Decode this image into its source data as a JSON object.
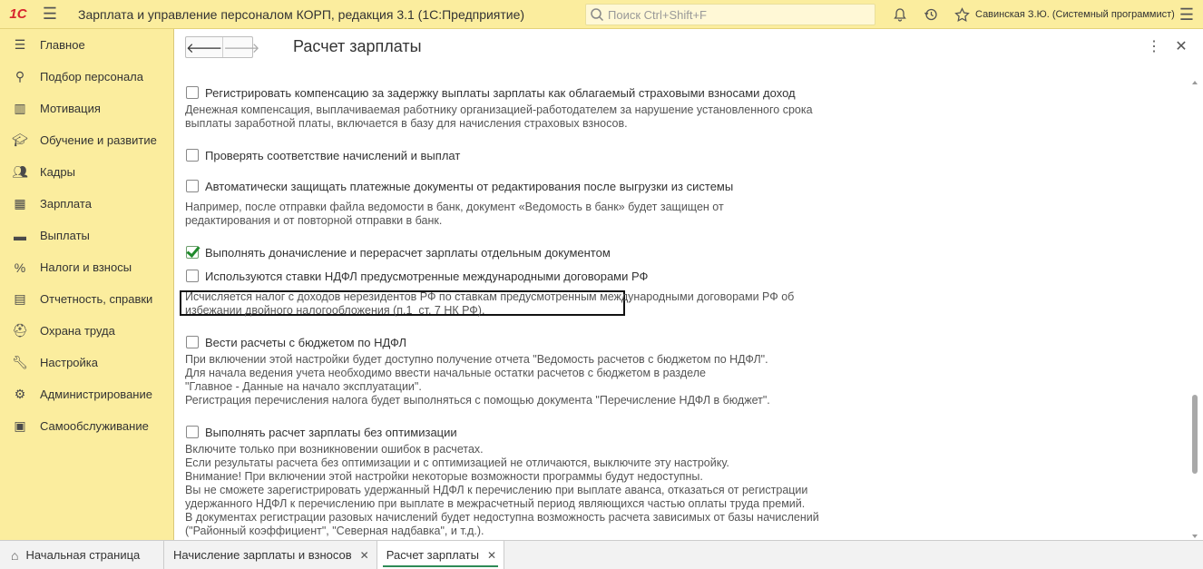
{
  "app": {
    "title": "Зарплата и управление персоналом КОРП, редакция 3.1   (1С:Предприятие)",
    "logo": "1С",
    "search_placeholder": "Поиск Ctrl+Shift+F",
    "user": "Савинская З.Ю. (Системный программист)"
  },
  "sidebar": {
    "items": [
      {
        "label": "Главное",
        "icon": "menu-lines-icon"
      },
      {
        "label": "Подбор персонала",
        "icon": "person-search-icon"
      },
      {
        "label": "Мотивация",
        "icon": "gift-icon"
      },
      {
        "label": "Обучение и развитие",
        "icon": "graduation-cap-icon"
      },
      {
        "label": "Кадры",
        "icon": "people-icon"
      },
      {
        "label": "Зарплата",
        "icon": "calculator-icon"
      },
      {
        "label": "Выплаты",
        "icon": "wallet-icon"
      },
      {
        "label": "Налоги и взносы",
        "icon": "percent-icon"
      },
      {
        "label": "Отчетность, справки",
        "icon": "report-icon"
      },
      {
        "label": "Охрана труда",
        "icon": "safety-icon"
      },
      {
        "label": "Настройка",
        "icon": "wrench-icon"
      },
      {
        "label": "Администрирование",
        "icon": "gear-icon"
      },
      {
        "label": "Самообслуживание",
        "icon": "id-card-icon"
      }
    ]
  },
  "form": {
    "title": "Расчет зарплаты"
  },
  "options": [
    {
      "label": "Регистрировать компенсацию за задержку выплаты зарплаты как облагаемый страховыми взносами доход",
      "checked": false,
      "description": "Денежная компенсация, выплачиваемая работнику организацией-работодателем за нарушение установленного срока\nвыплаты заработной платы, включается в базу для начисления страховых взносов."
    },
    {
      "label": "Проверять соответствие начислений и выплат",
      "checked": false,
      "description": ""
    },
    {
      "label": "Автоматически защищать платежные документы от редактирования после выгрузки из системы",
      "checked": false,
      "description": "Например, после отправки файла ведомости в банк, документ «Ведомость в банк» будет защищен от\nредактирования и от повторной отправки в банк."
    },
    {
      "label": "Выполнять доначисление и перерасчет зарплаты отдельным документом",
      "checked": true,
      "description": ""
    },
    {
      "label": "Используются ставки НДФЛ предусмотренные международными договорами РФ",
      "checked": false,
      "description": "Исчисляется налог с доходов нерезидентов РФ по ставкам предусмотренным международными договорами РФ об\nизбежании двойного налогообложения (п.1  ст. 7 НК РФ)."
    },
    {
      "label": "Вести расчеты с бюджетом по НДФЛ",
      "checked": false,
      "description": "При включении этой настройки будет доступно получение отчета \"Ведомость расчетов с бюджетом по НДФЛ\".\nДля начала ведения учета необходимо ввести начальные остатки расчетов с бюджетом в разделе\n\"Главное - Данные на начало эксплуатации\".\nРегистрация перечисления налога будет выполняться с помощью документа \"Перечисление НДФЛ в бюджет\"."
    },
    {
      "label": "Выполнять расчет зарплаты без оптимизации",
      "checked": false,
      "description": "Включите только при возникновении ошибок в расчетах.\nЕсли результаты расчета без оптимизации и с оптимизацией не отличаются, выключите эту настройку.\nВнимание! При включении этой настройки некоторые возможности программы будут недоступны.\nВы не сможете зарегистрировать удержанный НДФЛ к перечислению при выплате аванса, отказаться от регистрации\nудержанного НДФЛ к перечислению при выплате в межрасчетный период являющихся частью оплаты труда премий.\nВ документах регистрации разовых начислений будет недоступна возможность расчета зависимых от базы начислений\n(\"Районный коэффициент\", \"Северная надбавка\", и т.д.)."
    }
  ],
  "tabs": [
    {
      "label": "Начальная страница",
      "active": false,
      "closable": false
    },
    {
      "label": "Начисление зарплаты и взносов",
      "active": false,
      "closable": true
    },
    {
      "label": "Расчет зарплаты",
      "active": true,
      "closable": true
    }
  ],
  "scroll": {
    "position": 0.82,
    "visible_fraction": 0.18
  },
  "colors": {
    "chrome": "#fbed9e",
    "check": "#1f8a2b",
    "active_tab_underline": "#2e8b57"
  }
}
